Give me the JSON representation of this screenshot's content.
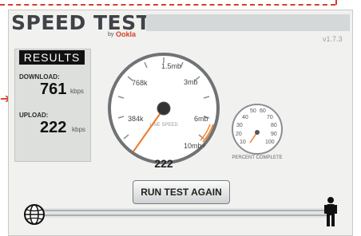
{
  "app": {
    "title": "SPEED TEST",
    "by_label": "by",
    "brand": "Ookla",
    "version": "v1.7.3"
  },
  "results": {
    "header": "RESULTS",
    "download": {
      "label": "DOWNLOAD:",
      "value": "761",
      "unit": "kbps"
    },
    "upload": {
      "label": "UPLOAD:",
      "value": "222",
      "unit": "kbps"
    }
  },
  "speed_gauge": {
    "tick_labels": [
      "384k",
      "768k",
      "1.5mb",
      "3mb",
      "6mb",
      "10mb+"
    ],
    "center_label": "LINE SPEED",
    "current_value": "222"
  },
  "percent_gauge": {
    "tick_labels": [
      "10",
      "20",
      "30",
      "40",
      "50",
      "60",
      "70",
      "80",
      "90",
      "100"
    ],
    "caption": "PERCENT COMPLETE"
  },
  "actions": {
    "run_again": "RUN TEST AGAIN"
  },
  "icons": [
    "globe-icon",
    "person-icon"
  ],
  "colors": {
    "accent": "#d6402c",
    "needle": "#f07a28",
    "panel": "#f1f1ef",
    "results_box": "#dcdfdc"
  }
}
